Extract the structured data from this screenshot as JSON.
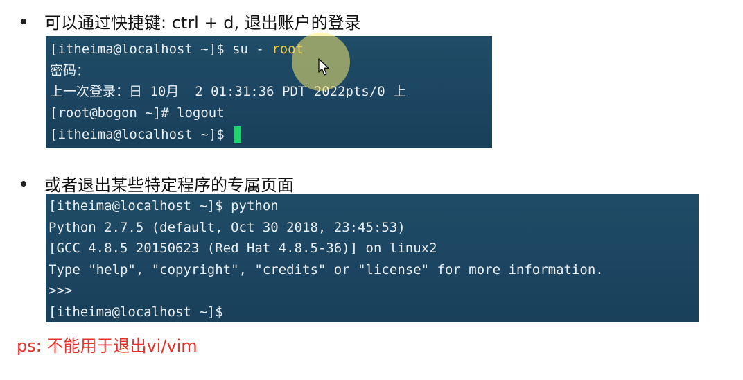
{
  "bullets": [
    {
      "text": "可以通过快捷键: ctrl + d, 退出账户的登录"
    },
    {
      "text": "或者退出某些特定程序的专属页面"
    }
  ],
  "terminal_1": {
    "line_1_prefix": "[itheima@localhost ~]$ su - ",
    "line_1_highlight": "root",
    "line_2": "密码：",
    "line_3": "上一次登录：日 10月  2 01:31:36 PDT 2022pts/0 上",
    "line_4": "[root@bogon ~]# logout",
    "line_5": "[itheima@localhost ~]$ "
  },
  "terminal_2": {
    "lines": [
      "[itheima@localhost ~]$ python",
      "Python 2.7.5 (default, Oct 30 2018, 23:45:53)",
      "[GCC 4.8.5 20150623 (Red Hat 4.8.5-36)] on linux2",
      "Type \"help\", \"copyright\", \"credits\" or \"license\" for more information.",
      ">>>",
      "[itheima@localhost ~]$"
    ]
  },
  "note": {
    "text": "ps: 不能用于退出vi/vim"
  },
  "colors": {
    "terminal_bg": "#1c4561",
    "terminal_text": "#e8eef2",
    "highlight": "#f2c84b",
    "cursor": "#22d36b",
    "note": "#e4312a",
    "pointer_halo": "#ffee70"
  },
  "icons": {
    "pointer": "mouse-pointer-icon",
    "cursor": "terminal-cursor"
  }
}
